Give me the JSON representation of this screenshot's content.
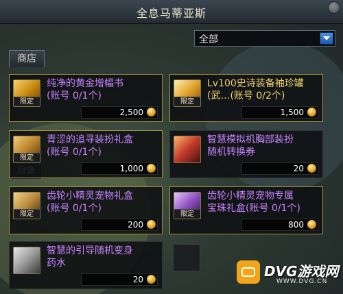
{
  "window": {
    "title": "全息马蒂亚斯"
  },
  "filter": {
    "selected": "全部"
  },
  "tabs": [
    {
      "label": "商店"
    }
  ],
  "side_label": "目录",
  "items": [
    {
      "name": "纯净的黄金增幅书\n(账号 0/1个)",
      "badge": "限定",
      "price": "2,500",
      "icon": "golden-book-icon",
      "icon_color": "#d4a017",
      "name_color": "#c882ff",
      "selected": true
    },
    {
      "name": "Lv100史诗装备袖珍罐\n(武…(账号 0/2个)",
      "badge": "限定",
      "price": "1,500",
      "icon": "epic-jar-icon",
      "icon_color": "#e8b040",
      "name_color": "#f0d36a",
      "selected": true
    },
    {
      "name": "青涩的追寻装扮礼盒\n(账号 0/1个)",
      "badge": "限定",
      "price": "1,000",
      "icon": "gift-box-icon",
      "icon_color": "#d9a441",
      "name_color": "#c882ff",
      "selected": true
    },
    {
      "name": "智慧模拟机胸部装扮\n随机转换券",
      "badge": "",
      "price": "20",
      "icon": "red-chest-icon",
      "icon_color": "#c0392b",
      "name_color": "#c882ff",
      "selected": false
    },
    {
      "name": "齿轮小精灵宠物礼盒\n(账号 0/1个)",
      "badge": "限定",
      "price": "200",
      "icon": "gear-gift-icon",
      "icon_color": "#c69a3a",
      "name_color": "#c882ff",
      "selected": true
    },
    {
      "name": "齿轮小精灵宠物专属\n宝珠礼盒(账号 0/1个)",
      "badge": "限定",
      "price": "800",
      "icon": "orb-gift-icon",
      "icon_color": "#b46bd6",
      "name_color": "#c882ff",
      "selected": true
    },
    {
      "name": "智慧的引导随机变身\n药水",
      "badge": "",
      "price": "20",
      "icon": "mystery-potion-icon",
      "icon_color": "#cfcfcf",
      "name_color": "#c882ff",
      "selected": false
    }
  ],
  "watermark": {
    "title": "DVG游戏网",
    "url": "WWW.DVG.CN"
  }
}
